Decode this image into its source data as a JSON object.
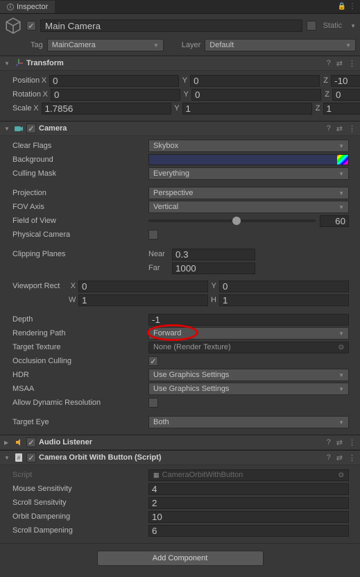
{
  "tab": {
    "title": "Inspector"
  },
  "header": {
    "name": "Main Camera",
    "static_label": "Static",
    "tag_label": "Tag",
    "tag_value": "MainCamera",
    "layer_label": "Layer",
    "layer_value": "Default"
  },
  "transform": {
    "title": "Transform",
    "position": {
      "label": "Position",
      "x": "0",
      "y": "0",
      "z": "-10"
    },
    "rotation": {
      "label": "Rotation",
      "x": "0",
      "y": "0",
      "z": "0"
    },
    "scale": {
      "label": "Scale",
      "x": "1.7856",
      "y": "1",
      "z": "1"
    }
  },
  "camera": {
    "title": "Camera",
    "clear_flags": {
      "label": "Clear Flags",
      "value": "Skybox"
    },
    "background": {
      "label": "Background",
      "value": "#31375a"
    },
    "culling_mask": {
      "label": "Culling Mask",
      "value": "Everything"
    },
    "projection": {
      "label": "Projection",
      "value": "Perspective"
    },
    "fov_axis": {
      "label": "FOV Axis",
      "value": "Vertical"
    },
    "fov": {
      "label": "Field of View",
      "value": "60"
    },
    "physical": {
      "label": "Physical Camera"
    },
    "clipping": {
      "label": "Clipping Planes",
      "near_label": "Near",
      "near": "0.3",
      "far_label": "Far",
      "far": "1000"
    },
    "viewport": {
      "label": "Viewport Rect",
      "x": "0",
      "y": "0",
      "w": "1",
      "h": "1"
    },
    "depth": {
      "label": "Depth",
      "value": "-1"
    },
    "rendering_path": {
      "label": "Rendering Path",
      "value": "Forward"
    },
    "target_texture": {
      "label": "Target Texture",
      "value": "None (Render Texture)"
    },
    "occlusion": {
      "label": "Occlusion Culling"
    },
    "hdr": {
      "label": "HDR",
      "value": "Use Graphics Settings"
    },
    "msaa": {
      "label": "MSAA",
      "value": "Use Graphics Settings"
    },
    "dynres": {
      "label": "Allow Dynamic Resolution"
    },
    "target_eye": {
      "label": "Target Eye",
      "value": "Both"
    }
  },
  "audio_listener": {
    "title": "Audio Listener"
  },
  "orbit": {
    "title": "Camera Orbit With Button (Script)",
    "script": {
      "label": "Script",
      "value": "CameraOrbitWithButton"
    },
    "mouse_sens": {
      "label": "Mouse Sensitivity",
      "value": "4"
    },
    "scroll_sens": {
      "label": "Scroll Sensitvity",
      "value": "2"
    },
    "orbit_damp": {
      "label": "Orbit Dampening",
      "value": "10"
    },
    "scroll_damp": {
      "label": "Scroll Dampening",
      "value": "6"
    }
  },
  "add_component": "Add Component",
  "axis": {
    "x": "X",
    "y": "Y",
    "z": "Z",
    "w": "W",
    "h": "H"
  }
}
